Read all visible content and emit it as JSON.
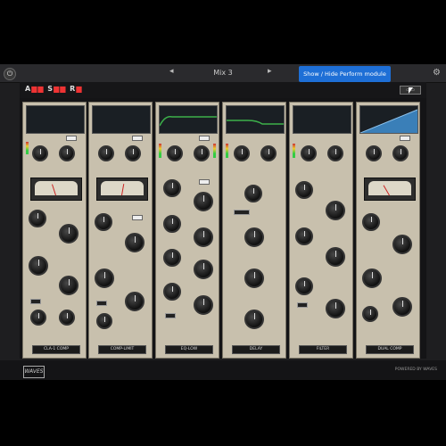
{
  "titlebar": {
    "preset": "Mix 3",
    "badge": "Show / Hide Perform module",
    "nav_prev": "◂",
    "nav_next": "▸"
  },
  "header": {
    "logo_a": "A",
    "logo_b": "S",
    "logo_c": "R"
  },
  "strips": [
    {
      "name": "strip-1",
      "type": "CLA-1 COMP",
      "display": "flat"
    },
    {
      "name": "strip-2",
      "type": "COMP-LIMIT",
      "display": "flat"
    },
    {
      "name": "strip-3",
      "type": "EQ-LOW",
      "display": "curve-green"
    },
    {
      "name": "strip-4",
      "type": "DELAY",
      "display": "curve-green2"
    },
    {
      "name": "strip-5",
      "type": "FILTER",
      "display": "flat"
    },
    {
      "name": "strip-6",
      "type": "DUAL COMP",
      "display": "rise-blue"
    }
  ],
  "footer": {
    "brand": "WAVES",
    "powered": "POWERED BY WAVES"
  },
  "colors": {
    "accent": "#1e6fd6",
    "panel": "#c8c0ad",
    "logo_red": "#e33"
  }
}
